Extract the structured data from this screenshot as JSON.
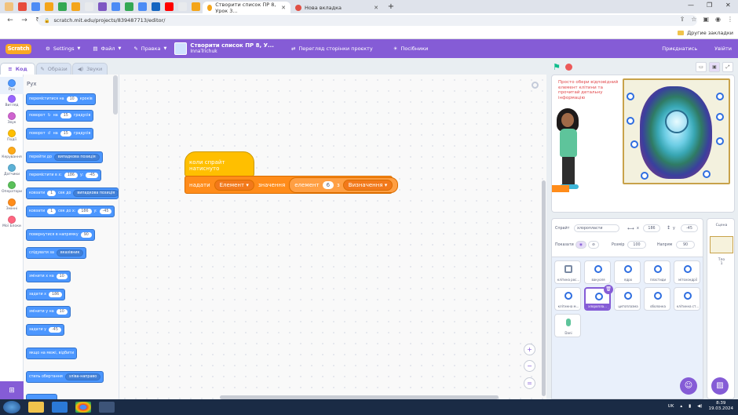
{
  "browser": {
    "tabs": [
      {
        "title": "Створити список ПР 8, Урок 3...",
        "active": true,
        "fav_color": "#f4a51a"
      },
      {
        "title": "Нова вкладка",
        "active": false,
        "fav_color": "#e04f44"
      }
    ],
    "url": "scratch.mit.edu/projects/839487713/editor/",
    "other_bookmarks": "Другие закладки"
  },
  "menubar": {
    "logo": "Scratch",
    "settings": "Settings",
    "file": "Файл",
    "edit": "Правка",
    "project_title": "Створити список ПР 8, У...",
    "project_author": "InnaTrichuk",
    "see_project_page": "Перегляд сторінки проєкту",
    "tutorials": "Посібники",
    "share": "Приєднатись",
    "sign_in": "Увійти"
  },
  "editor_tabs": {
    "code": "Код",
    "costumes": "Образи",
    "sounds": "Звуки"
  },
  "categories": [
    {
      "label": "Рух",
      "color": "#4c97ff"
    },
    {
      "label": "Вигляд",
      "color": "#9966ff"
    },
    {
      "label": "Звук",
      "color": "#cf63cf"
    },
    {
      "label": "Події",
      "color": "#ffbf00"
    },
    {
      "label": "Керування",
      "color": "#ffab19"
    },
    {
      "label": "Датчики",
      "color": "#5cb1d6"
    },
    {
      "label": "Оператори",
      "color": "#59c059"
    },
    {
      "label": "Змінні",
      "color": "#ff8c1a"
    },
    {
      "label": "Мої Блоки",
      "color": "#ff6680"
    }
  ],
  "palette": {
    "heading": "Рух",
    "blocks": {
      "move": {
        "text": "переміститися на",
        "value": "10",
        "suffix": "кроків"
      },
      "turn_right": {
        "text": "поворот",
        "mid": "на",
        "value": "15",
        "suffix": "градусів"
      },
      "turn_left": {
        "text": "поворот",
        "mid": "на",
        "value": "15",
        "suffix": "градусів"
      },
      "goto": {
        "text": "перейти до",
        "dropdown": "випадкова позиція"
      },
      "goto_xy": {
        "text": "перемістити в x:",
        "x": "186",
        "ylabel": "y:",
        "y": "-45"
      },
      "glide_to": {
        "text": "ковзати",
        "secs": "1",
        "mid": "сек до",
        "dropdown": "випадкова позиція"
      },
      "glide_xy": {
        "text": "ковзати",
        "secs": "1",
        "mid": "сек до x:",
        "x": "186",
        "ylabel": "y:",
        "y": "-45"
      },
      "point_dir": {
        "text": "повернутися в напрямку",
        "value": "90"
      },
      "point_towards": {
        "text": "слідувати за",
        "dropdown": "вказівник"
      },
      "change_x": {
        "text": "змінити x на",
        "value": "10"
      },
      "set_x": {
        "text": "задати x",
        "value": "186"
      },
      "change_y": {
        "text": "змінити y на",
        "value": "10"
      },
      "set_y": {
        "text": "задати y",
        "value": "-45"
      },
      "bounce": {
        "text": "якщо на межі, відбити"
      },
      "rotation_style": {
        "text": "стиль обертання",
        "dropdown": "зліва-направо"
      }
    }
  },
  "script": {
    "hat": "коли спрайт натиснуто",
    "say_prefix": "надати",
    "var_dropdown": "Елемент",
    "say_mid": "значення",
    "item_label": "елемент",
    "item_index": "6",
    "of_label": "з",
    "list_dropdown": "Визначення"
  },
  "stage": {
    "hint": "Просто обери відповідний елемент клітини та прочитай детальну інформацію"
  },
  "sprite_info": {
    "sprite_label": "Спрайт",
    "sprite_name": "хлоропласти",
    "x_label": "x",
    "x_value": "186",
    "y_label": "y",
    "y_value": "-45",
    "show_label": "Показати",
    "size_label": "Розмір",
    "size_value": "100",
    "direction_label": "Напрям",
    "direction_value": "90"
  },
  "sprites": [
    {
      "name": "клітина рос..."
    },
    {
      "name": "вакуоля"
    },
    {
      "name": "ядро"
    },
    {
      "name": "пластиди"
    },
    {
      "name": "мітохондрії"
    },
    {
      "name": "клітинна м..."
    },
    {
      "name": "хлоропла...",
      "selected": true
    },
    {
      "name": "цитоплазма"
    },
    {
      "name": "оболонка"
    },
    {
      "name": "клітинна ст..."
    },
    {
      "name": "Dani"
    }
  ],
  "stage_panel": {
    "label": "Сцена",
    "backdrops_label": "Тло",
    "backdrops_count": "1"
  },
  "taskbar": {
    "lang": "UK",
    "time": "8:39",
    "date": "19.03.2024"
  }
}
